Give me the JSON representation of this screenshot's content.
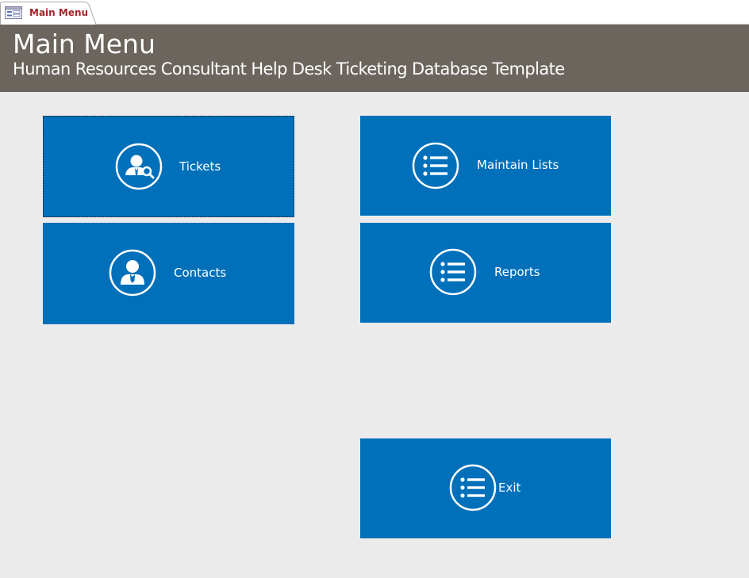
{
  "tab": {
    "label": "Main Menu",
    "icon": "form-icon"
  },
  "header": {
    "title": "Main Menu",
    "subtitle": "Human Resources Consultant Help Desk Ticketing Database Template"
  },
  "buttons": {
    "tickets": {
      "label": "Tickets",
      "icon": "user-search-icon"
    },
    "contacts": {
      "label": "Contacts",
      "icon": "user-tie-icon"
    },
    "maintain_lists": {
      "label": "Maintain Lists",
      "icon": "list-icon"
    },
    "reports": {
      "label": "Reports",
      "icon": "list-icon"
    },
    "exit": {
      "label": "Exit",
      "icon": "list-icon"
    }
  },
  "colors": {
    "tile": "#0070ba",
    "header": "#6b655e",
    "background": "#ebebeb",
    "tab_label": "#a4262c"
  }
}
